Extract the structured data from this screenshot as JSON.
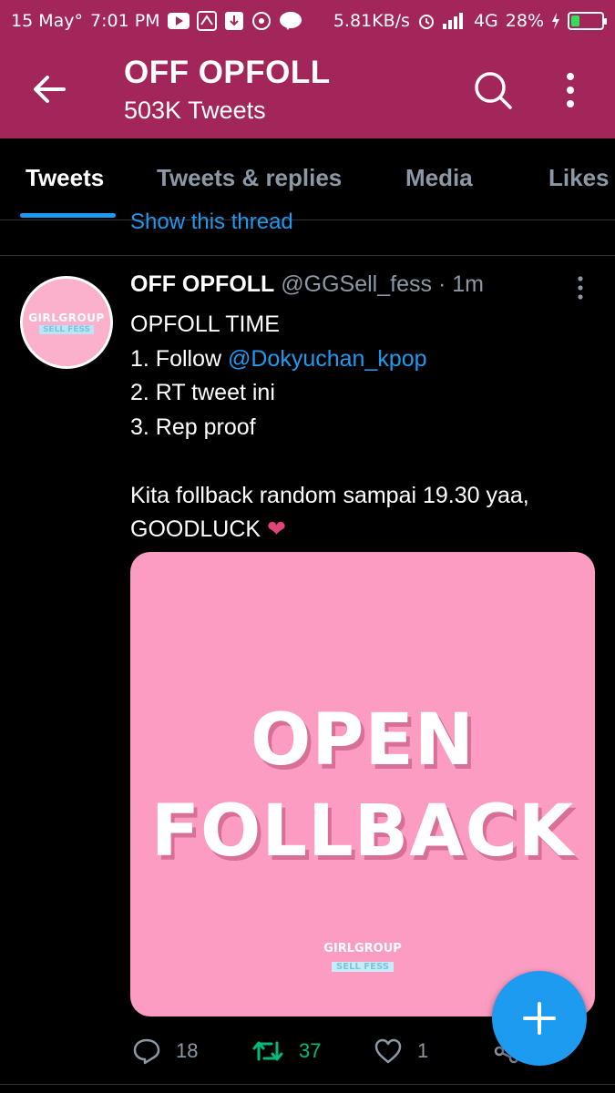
{
  "status_bar": {
    "date": "15 May°",
    "time": "7:01 PM",
    "speed": "5.81KB/s",
    "network": "4G",
    "battery": "28%",
    "battery_level": 0.28
  },
  "header": {
    "title": "OFF OPFOLL",
    "subtitle": "503K Tweets"
  },
  "tabs": [
    {
      "label": "Tweets",
      "active": true
    },
    {
      "label": "Tweets & replies",
      "active": false
    },
    {
      "label": "Media",
      "active": false
    },
    {
      "label": "Likes",
      "active": false
    }
  ],
  "show_thread": "Show this thread",
  "tweet": {
    "name": "OFF OPFOLL",
    "handle": "@GGSell_fess",
    "time": "· 1m",
    "avatar": {
      "line1": "GIRLGROUP",
      "line2": "SELL FESS"
    },
    "text": {
      "line1": "OPFOLL TIME",
      "line2_prefix": "1. Follow ",
      "mention": "@Dokyuchan_kpop",
      "line3": "2. RT tweet ini",
      "line4": "3. Rep proof",
      "line5": "Kita follback random sampai 19.30 yaa,",
      "line6": "GOODLUCK ",
      "emoji": "❤"
    },
    "media": {
      "line1": "OPEN",
      "line2": "FOLLBACK",
      "logo1": "GIRLGROUP",
      "logo2": "SELL FESS"
    },
    "actions": {
      "replies": "18",
      "retweets": "37",
      "likes": "1"
    }
  },
  "colors": {
    "header_bg": "#a3265a",
    "accent": "#1d9bf0",
    "retweet_active": "#00ba7c",
    "media_bg": "#fd9cc2"
  }
}
